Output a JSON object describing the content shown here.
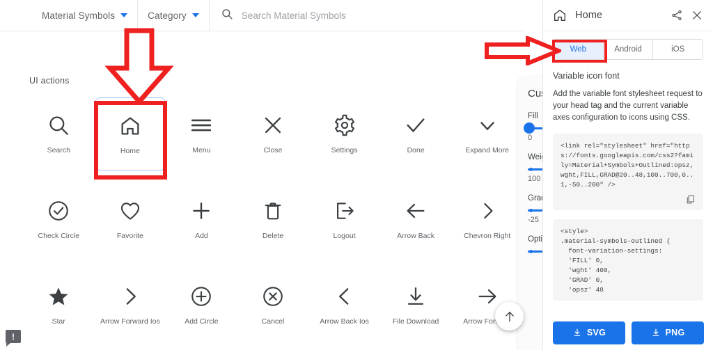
{
  "topbar": {
    "family_label": "Material Symbols",
    "category_label": "Category",
    "search_placeholder": "Search Material Symbols",
    "search_value": "",
    "search_icon": "search-icon",
    "family_caret_icon": "chevron-down-icon",
    "category_caret_icon": "chevron-down-icon"
  },
  "gallery": {
    "section_title": "UI actions",
    "selected_icon": "Home",
    "fab_icon": "arrow-upward-icon",
    "feedback_icon": "feedback-icon",
    "icons": [
      {
        "label": "Search",
        "icon": "search-icon"
      },
      {
        "label": "Home",
        "icon": "home-icon"
      },
      {
        "label": "Menu",
        "icon": "menu-icon"
      },
      {
        "label": "Close",
        "icon": "close-icon"
      },
      {
        "label": "Settings",
        "icon": "settings-gear-icon"
      },
      {
        "label": "Done",
        "icon": "check-icon"
      },
      {
        "label": "Expand More",
        "icon": "chevron-down-icon"
      },
      {
        "label": "Check Circle",
        "icon": "check-circle-icon"
      },
      {
        "label": "Favorite",
        "icon": "heart-icon"
      },
      {
        "label": "Add",
        "icon": "plus-icon"
      },
      {
        "label": "Delete",
        "icon": "trash-icon"
      },
      {
        "label": "Logout",
        "icon": "logout-icon"
      },
      {
        "label": "Arrow Back",
        "icon": "arrow-back-icon"
      },
      {
        "label": "Chevron Right",
        "icon": "chevron-right-icon"
      },
      {
        "label": "Star",
        "icon": "star-filled-icon"
      },
      {
        "label": "Arrow Forward Ios",
        "icon": "chevron-right-thin-icon"
      },
      {
        "label": "Add Circle",
        "icon": "plus-circle-icon"
      },
      {
        "label": "Cancel",
        "icon": "cancel-circle-icon"
      },
      {
        "label": "Arrow Back Ios",
        "icon": "chevron-left-thin-icon"
      },
      {
        "label": "File Download",
        "icon": "download-icon"
      },
      {
        "label": "Arrow Forward",
        "icon": "arrow-forward-icon"
      }
    ]
  },
  "customize": {
    "title": "Customize",
    "fill_label": "Fill",
    "fill_value": "0",
    "weight_label": "Weight",
    "weight_value": "100",
    "grade_label": "Grade",
    "grade_value": "-25",
    "optical_label": "Optical size"
  },
  "detail": {
    "title": "Home",
    "home_icon": "home-icon",
    "share_icon": "share-icon",
    "close_icon": "close-icon",
    "tabs": [
      {
        "label": "Web",
        "active": true
      },
      {
        "label": "Android",
        "active": false
      },
      {
        "label": "iOS",
        "active": false
      }
    ],
    "section_heading": "Variable icon font",
    "section_body": "Add the variable font stylesheet request to your head tag and the current variable axes configuration to icons using CSS.",
    "code_link": "<link rel=\"stylesheet\" href=\"https://fonts.googleapis.com/css2?family=Material+Symbols+Outlined:opsz,wght,FILL,GRAD@20..48,100..700,0..1,-50..200\" />",
    "code_style": "<style>\n.material-symbols-outlined {\n  font-variation-settings:\n  'FILL' 0,\n  'wght' 400,\n  'GRAD' 0,\n  'opsz' 48",
    "copy_icon": "copy-icon",
    "download_svg_label": "SVG",
    "download_png_label": "PNG",
    "download_icon": "download-icon"
  },
  "annotations": {
    "color": "#ee2020",
    "arrow_down_target": "Home",
    "arrow_right_target": "Web",
    "box_home": "home-icon-highlight",
    "box_web": "web-tab-highlight"
  },
  "colors": {
    "accent_blue": "#1a73e8",
    "tab_active_bg": "#e8f0fe",
    "annotation_red": "#ee2020",
    "text_primary": "#3c4043",
    "text_secondary": "#5f6368"
  }
}
